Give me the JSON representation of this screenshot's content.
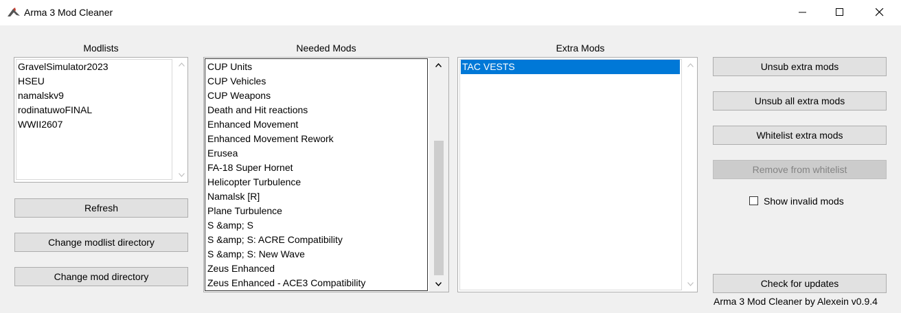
{
  "window": {
    "title": "Arma 3 Mod Cleaner"
  },
  "modlists": {
    "label": "Modlists",
    "items": [
      "GravelSimulator2023",
      "HSEU",
      "namalskv9",
      "rodinatuwoFINAL",
      "WWII2607"
    ]
  },
  "needed_mods": {
    "label": "Needed Mods",
    "items": [
      "CUP Units",
      "CUP Vehicles",
      "CUP Weapons",
      "Death and Hit reactions",
      "Enhanced Movement",
      "Enhanced Movement Rework",
      "Erusea",
      "FA-18 Super Hornet",
      "Helicopter Turbulence",
      "Namalsk [R]",
      "Plane Turbulence",
      "S &amp; S",
      "S &amp; S: ACRE Compatibility",
      "S &amp; S: New Wave",
      "Zeus Enhanced",
      "Zeus Enhanced - ACE3 Compatibility"
    ]
  },
  "extra_mods": {
    "label": "Extra Mods",
    "items": [
      "TAC VESTS"
    ],
    "selected_index": 0
  },
  "left_buttons": {
    "refresh": "Refresh",
    "change_modlist_dir": "Change modlist directory",
    "change_mod_dir": "Change mod directory"
  },
  "right_buttons": {
    "unsub_extra": "Unsub extra mods",
    "unsub_all_extra": "Unsub all extra mods",
    "whitelist_extra": "Whitelist extra mods",
    "remove_whitelist": "Remove from whitelist",
    "check_updates": "Check for updates"
  },
  "options": {
    "show_invalid_label": "Show invalid mods",
    "show_invalid_checked": false
  },
  "footer": {
    "credit": "Arma 3 Mod Cleaner by Alexein v0.9.4"
  }
}
